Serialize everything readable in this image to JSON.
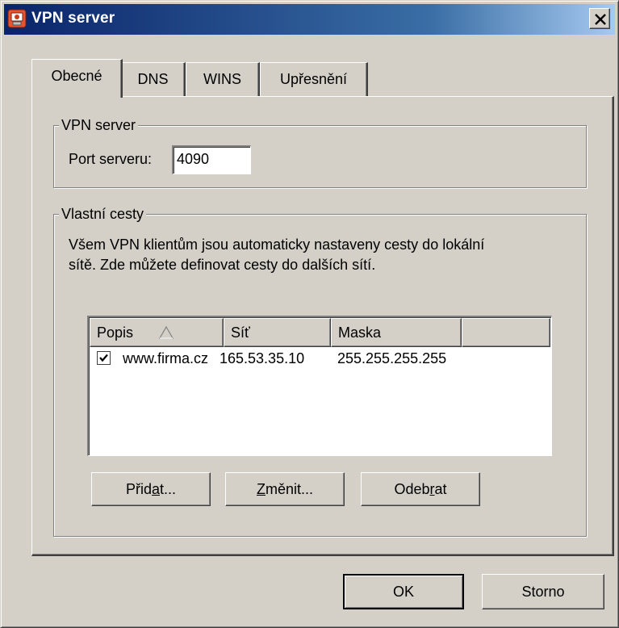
{
  "window": {
    "title": "VPN server",
    "icon": "vpn-server-icon",
    "close_icon": "close-icon"
  },
  "tabs": [
    {
      "label": "Obecné",
      "active": true
    },
    {
      "label": "DNS",
      "active": false
    },
    {
      "label": "WINS",
      "active": false
    },
    {
      "label": "Upřesnění",
      "active": false
    }
  ],
  "vpn_group": {
    "title": "VPN server",
    "port_label": "Port serveru:",
    "port_value": "4090"
  },
  "routes_group": {
    "title": "Vlastní cesty",
    "description_line1": "Všem VPN klientům jsou automaticky nastaveny cesty do lokální",
    "description_line2": "sítě. Zde můžete definovat cesty do dalších sítí.",
    "columns": [
      "Popis",
      "Síť",
      "Maska",
      ""
    ],
    "sort_indicator": "sort-ascending-icon",
    "rows": [
      {
        "checked": true,
        "popis": "www.firma.cz",
        "sit": "165.53.35.10",
        "maska": "255.255.255.255"
      }
    ],
    "buttons": {
      "add": {
        "before": "Přid",
        "mnemonic": "a",
        "after": "t..."
      },
      "edit": {
        "before": "",
        "mnemonic": "Z",
        "after": "měnit..."
      },
      "remove": {
        "before": "Odeb",
        "mnemonic": "r",
        "after": "at"
      }
    }
  },
  "footer": {
    "ok_label": "OK",
    "cancel_label": "Storno"
  },
  "colors": {
    "face": "#d4d0c8",
    "title_start": "#0a246a",
    "title_end": "#a6caf0"
  }
}
